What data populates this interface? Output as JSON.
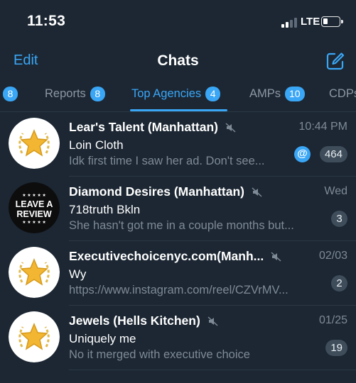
{
  "status_bar": {
    "time": "11:53",
    "network": "LTE",
    "signal_bars_active": 2,
    "battery_level": 0.2
  },
  "nav": {
    "edit_label": "Edit",
    "title": "Chats",
    "compose_icon": "compose-icon"
  },
  "tabs": [
    {
      "label": "",
      "count": "8",
      "active": false
    },
    {
      "label": "Reports",
      "count": "8",
      "active": false
    },
    {
      "label": "Top Agencies",
      "count": "4",
      "active": true
    },
    {
      "label": "AMPs",
      "count": "10",
      "active": false
    },
    {
      "label": "CDPs",
      "count": "",
      "active": false
    }
  ],
  "colors": {
    "background": "#1c2733",
    "accent": "#3aa6f6",
    "muted_text": "#7e8a96",
    "badge_gray": "#3f4d5b"
  },
  "chats": [
    {
      "name": "Lear's Talent (Manhattan)",
      "time": "10:44 PM",
      "sender": "Loin Cloth",
      "preview": "Idk first time I saw her ad. Don't see...",
      "unread": "464",
      "mention": "@",
      "muted": true,
      "avatar": "gold-star-avatar"
    },
    {
      "name": "Diamond Desires (Manhattan)",
      "time": "Wed",
      "sender": "718truth Bkln",
      "preview": "She hasn't got me in a couple months but...",
      "unread": "3",
      "muted": true,
      "avatar": "leave-a-review-avatar",
      "avatar_text": [
        "LEAVE A",
        "REVIEW"
      ]
    },
    {
      "name": "Executivechoicenyc.com(Manh...",
      "time": "02/03",
      "sender": "Wy",
      "preview": "https://www.instagram.com/reel/CZVrMV...",
      "unread": "2",
      "muted": true,
      "avatar": "gold-star-avatar"
    },
    {
      "name": "Jewels (Hells Kitchen)",
      "time": "01/25",
      "sender": "Uniquely me",
      "preview": "No it merged with executive choice",
      "unread": "19",
      "muted": true,
      "avatar": "gold-star-avatar"
    }
  ]
}
